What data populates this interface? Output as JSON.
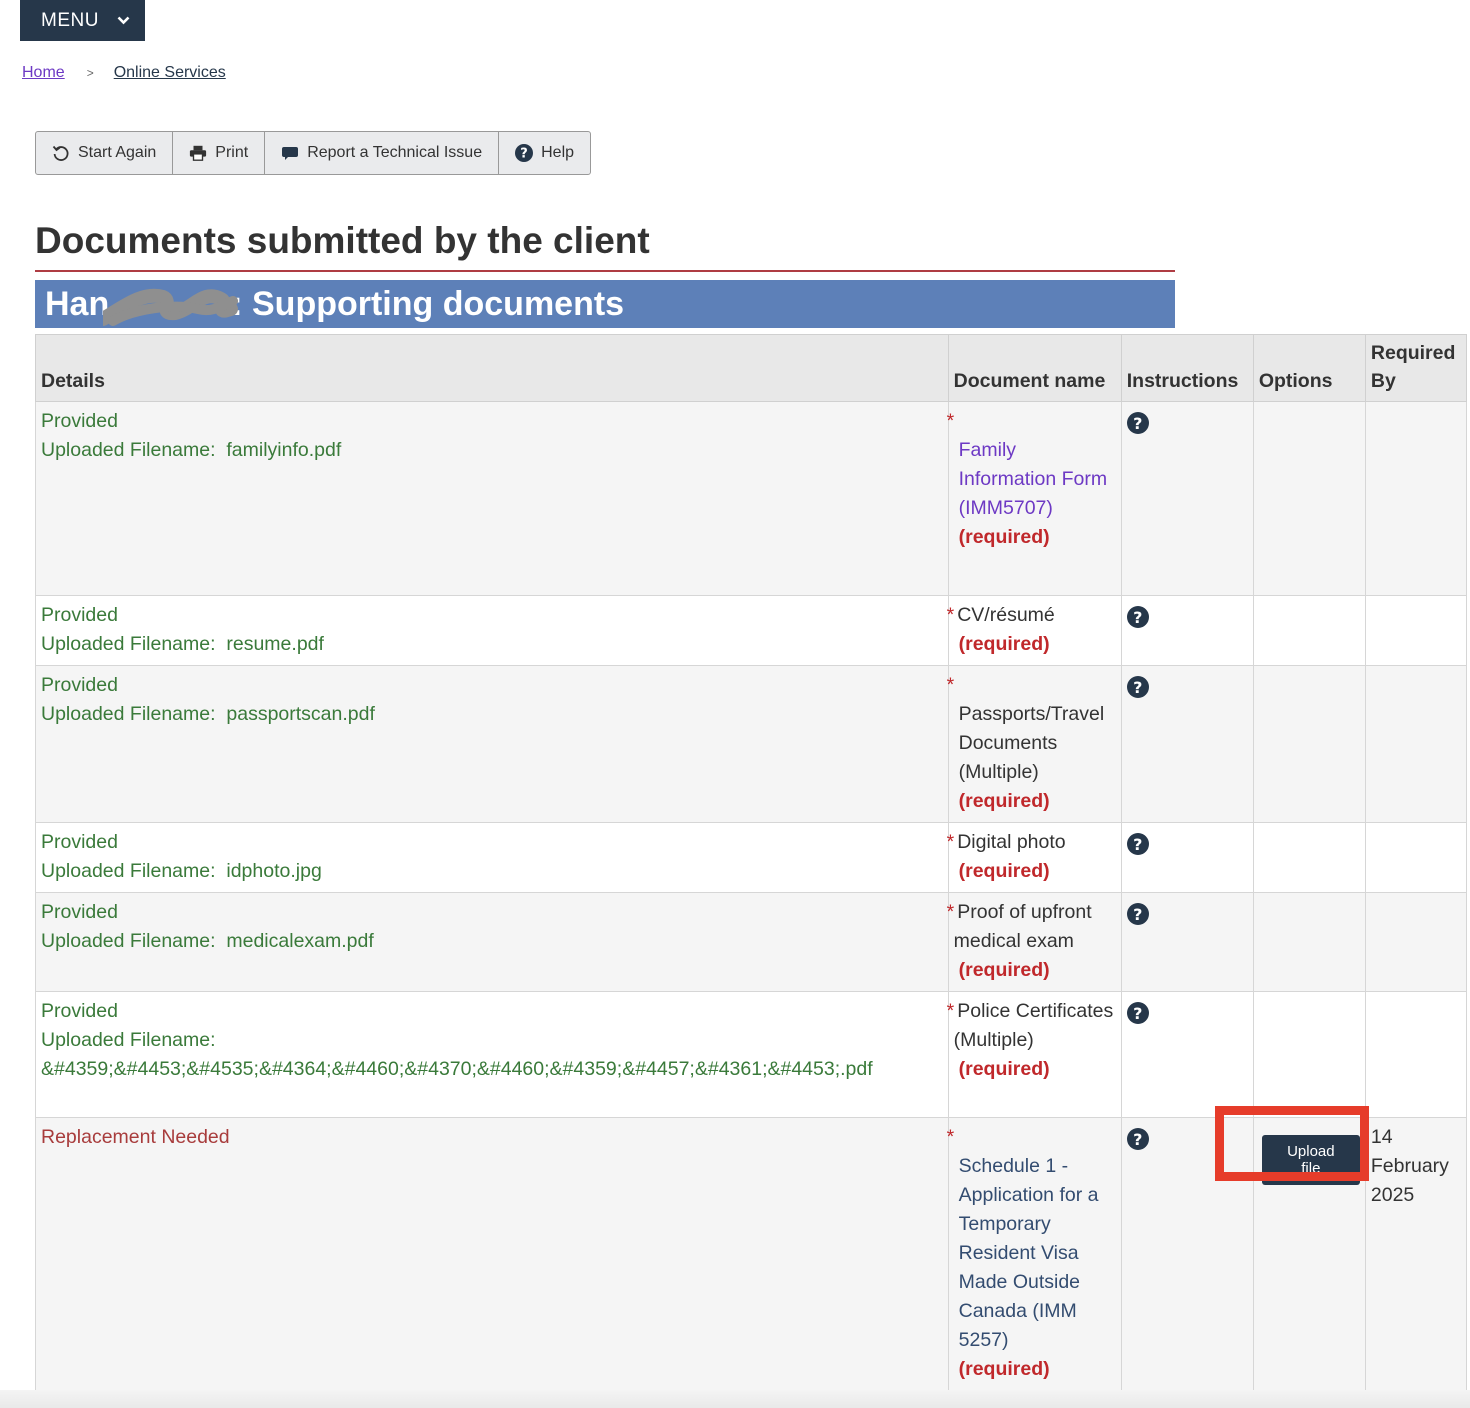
{
  "menu": {
    "label": "MENU"
  },
  "breadcrumb": {
    "home": "Home",
    "separator": ">",
    "current": "Online Services"
  },
  "toolbar": {
    "start_again": "Start Again",
    "print": "Print",
    "report": "Report a Technical Issue",
    "help": "Help"
  },
  "page": {
    "title": "Documents submitted by the client",
    "section_prefix": "Han",
    "section_suffix": ": Supporting documents"
  },
  "table": {
    "headers": {
      "details": "Details",
      "document_name": "Document name",
      "instructions": "Instructions",
      "options": "Options",
      "required_by": "Required By"
    },
    "required_tag": "(required)",
    "star": "*",
    "help_glyph": "?",
    "rows": [
      {
        "status": "Provided",
        "filename_label": "Uploaded Filename:",
        "filename": "familyinfo.pdf",
        "document": "Family Information Form (IMM5707)"
      },
      {
        "status": "Provided",
        "filename_label": "Uploaded Filename:",
        "filename": "resume.pdf",
        "document": "CV/résumé"
      },
      {
        "status": "Provided",
        "filename_label": "Uploaded Filename:",
        "filename": "passportscan.pdf",
        "document": "Passports/Travel Documents (Multiple)"
      },
      {
        "status": "Provided",
        "filename_label": "Uploaded Filename:",
        "filename": "idphoto.jpg",
        "document": "Digital photo"
      },
      {
        "status": "Provided",
        "filename_label": "Uploaded Filename:",
        "filename": "medicalexam.pdf",
        "document": "Proof of upfront medical exam"
      },
      {
        "status": "Provided",
        "filename_label": "Uploaded Filename:",
        "filename": "&#4359;&#4453;&#4535;&#4364;&#4460;&#4370;&#4460;&#4359;&#4457;&#4361;&#4453;.pdf",
        "document": "Police Certificates (Multiple)"
      },
      {
        "status": "Replacement Needed",
        "document": "Schedule 1 - Application for a Temporary Resident Visa Made Outside Canada (IMM 5257)",
        "option_button": "Upload file",
        "required_by": "14 February 2025"
      }
    ]
  },
  "colors": {
    "nav_dark": "#26374a",
    "section_band": "#5d80b8",
    "provided_green": "#3a7a3a",
    "replacement_red": "#a83c3c",
    "required_red": "#c0282b",
    "highlight": "#e63c2a"
  }
}
